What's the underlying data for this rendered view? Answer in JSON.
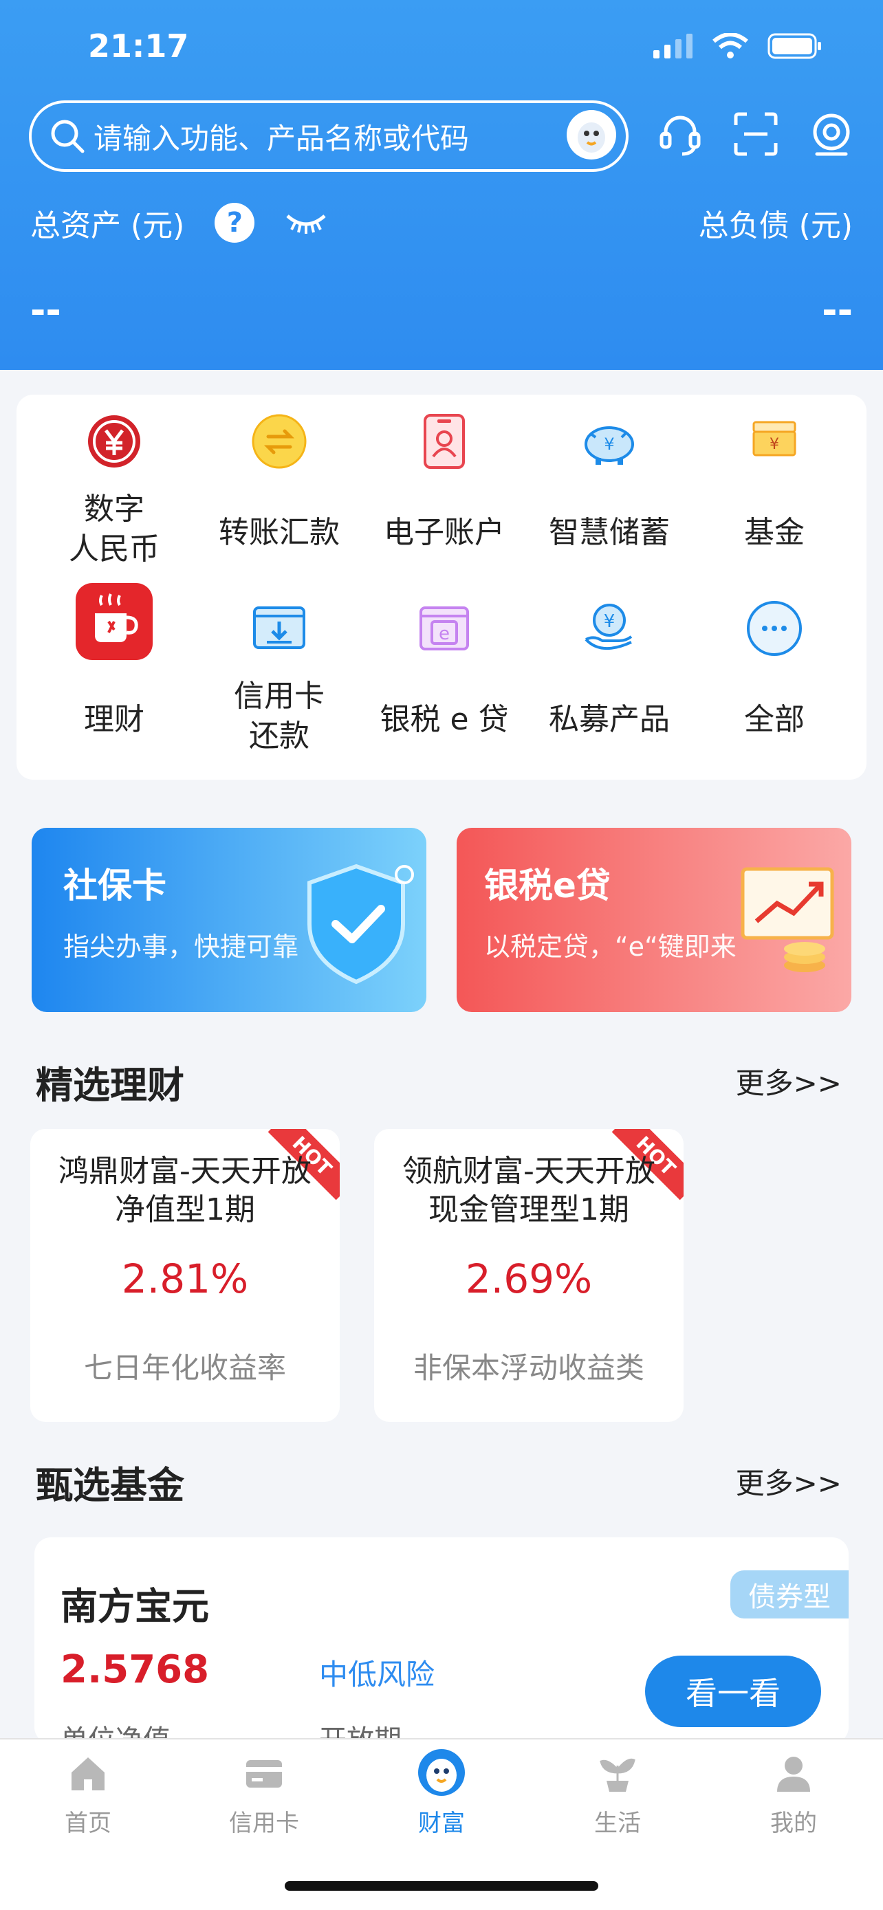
{
  "status": {
    "time": "21:17"
  },
  "header": {
    "search_placeholder": "请输入功能、产品名称或代码",
    "total_assets_label": "总资产 (元)",
    "total_assets_value": "--",
    "total_debt_label": "总负债 (元)",
    "total_debt_value": "--",
    "help_symbol": "?"
  },
  "grid": {
    "items": [
      {
        "label": "数字\n人民币",
        "icon": "digital-rmb-icon"
      },
      {
        "label": "转账汇款",
        "icon": "transfer-icon"
      },
      {
        "label": "电子账户",
        "icon": "e-account-icon"
      },
      {
        "label": "智慧储蓄",
        "icon": "piggy-bank-icon"
      },
      {
        "label": "基金",
        "icon": "fund-icon"
      },
      {
        "label": "理财",
        "icon": "wealth-cup-icon"
      },
      {
        "label": "信用卡\n还款",
        "icon": "card-repay-icon"
      },
      {
        "label": "银税 e 贷",
        "icon": "tax-loan-icon"
      },
      {
        "label": "私募产品",
        "icon": "private-fund-icon"
      },
      {
        "label": "全部",
        "icon": "more-dots-icon"
      }
    ]
  },
  "promos": [
    {
      "title": "社保卡",
      "subtitle": "指尖办事，快捷可靠"
    },
    {
      "title": "银税e贷",
      "subtitle": "以税定贷，“e“键即来"
    }
  ],
  "featured": {
    "title": "精选理财",
    "more": "更多>>",
    "hot_label": "HOT",
    "products": [
      {
        "name_line1": "鸿鼎财富-天天开放",
        "name_line2": "净值型1期",
        "rate": "2.81%",
        "note": "七日年化收益率"
      },
      {
        "name_line1": "领航财富-天天开放",
        "name_line2": "现金管理型1期",
        "rate": "2.69%",
        "note": "非保本浮动收益类"
      }
    ]
  },
  "funds": {
    "title": "甄选基金",
    "more": "更多>>",
    "card": {
      "name": "南方宝元",
      "tag": "债券型",
      "nav": "2.5768",
      "nav_label": "单位净值",
      "risk": "中低风险",
      "period_label": "开放期",
      "button": "看一看"
    }
  },
  "tabbar": {
    "items": [
      {
        "label": "首页",
        "icon": "home-icon"
      },
      {
        "label": "信用卡",
        "icon": "credit-card-icon"
      },
      {
        "label": "财富",
        "icon": "mascot-icon"
      },
      {
        "label": "生活",
        "icon": "sprout-icon"
      },
      {
        "label": "我的",
        "icon": "person-icon"
      }
    ],
    "active": "财富"
  },
  "colors": {
    "primary": "#2e8cf0",
    "red": "#d81e2a"
  }
}
